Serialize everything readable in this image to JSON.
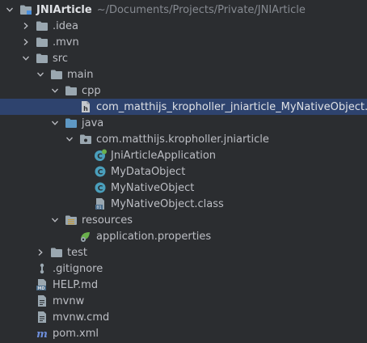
{
  "project_tree": {
    "project": {
      "name": "JNIArticle",
      "path": "~/Documents/Projects/Private/JNIArticle"
    },
    "items": [
      {
        "label": ".idea"
      },
      {
        "label": ".mvn"
      },
      {
        "label": "src"
      },
      {
        "label": "main"
      },
      {
        "label": "cpp"
      },
      {
        "label": "com_matthijs_kropholler_jniarticle_MyNativeObject.h"
      },
      {
        "label": "java"
      },
      {
        "label": "com.matthijs.kropholler.jniarticle"
      },
      {
        "label": "JniArticleApplication"
      },
      {
        "label": "MyDataObject"
      },
      {
        "label": "MyNativeObject"
      },
      {
        "label": "MyNativeObject.class"
      },
      {
        "label": "resources"
      },
      {
        "label": "application.properties"
      },
      {
        "label": "test"
      },
      {
        "label": ".gitignore"
      },
      {
        "label": "HELP.md"
      },
      {
        "label": "mvnw"
      },
      {
        "label": "mvnw.cmd"
      },
      {
        "label": "pom.xml"
      }
    ]
  },
  "colors": {
    "background": "#2b2d30",
    "selection": "#2e436e",
    "folder": "#9aa7b0",
    "source_folder": "#5e98c4",
    "class_icon": "#4a9fbc",
    "spring_icon": "#6ab04c"
  }
}
